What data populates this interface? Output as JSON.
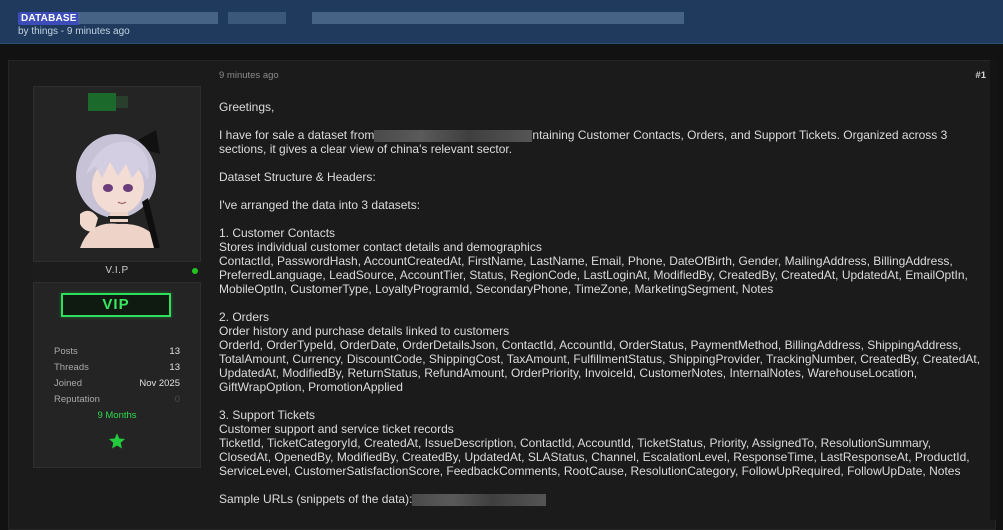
{
  "header": {
    "prefix": "DATABASE",
    "byline": "by things - 9 minutes ago"
  },
  "user": {
    "rank_title": "V.I.P",
    "badge": "VIP",
    "stats": [
      {
        "label": "Posts",
        "value": "13"
      },
      {
        "label": "Threads",
        "value": "13"
      },
      {
        "label": "Joined",
        "value": "Nov 2025"
      },
      {
        "label": "Reputation",
        "value": "0"
      }
    ],
    "membership": "9 Months"
  },
  "post": {
    "time": "9 minutes ago",
    "number": "#1",
    "greeting": "Greetings,",
    "intro_part1": "I have for sale a dataset from",
    "intro_part2": "ntaining Customer Contacts, Orders, and Support Tickets. Organized across 3",
    "intro_line2": "sections, it gives a clear view of china's relevant sector.",
    "structure_heading": "Dataset Structure & Headers:",
    "arranged": "I've arranged the data into 3 datasets:",
    "sections": [
      {
        "title": "1. Customer Contacts",
        "desc": "Stores individual customer contact details and demographics",
        "lines": [
          "ContactId, PasswordHash, AccountCreatedAt, FirstName, LastName, Email, Phone, DateOfBirth, Gender, MailingAddress, BillingAddress,",
          "PreferredLanguage, LeadSource, AccountTier, Status, RegionCode, LastLoginAt, ModifiedBy, CreatedBy, CreatedAt, UpdatedAt, EmailOptIn,",
          "MobileOptIn, CustomerType, LoyaltyProgramId, SecondaryPhone, TimeZone, MarketingSegment, Notes"
        ]
      },
      {
        "title": "2. Orders",
        "desc": "Order history and purchase details linked to customers",
        "lines": [
          "OrderId, OrderTypeId, OrderDate, OrderDetailsJson, ContactId, AccountId, OrderStatus, PaymentMethod, BillingAddress, ShippingAddress,",
          "TotalAmount, Currency, DiscountCode, ShippingCost, TaxAmount, FulfillmentStatus, ShippingProvider, TrackingNumber, CreatedBy, CreatedAt,",
          "UpdatedAt, ModifiedBy, ReturnStatus, RefundAmount, OrderPriority, InvoiceId, CustomerNotes, InternalNotes, WarehouseLocation,",
          "GiftWrapOption, PromotionApplied"
        ]
      },
      {
        "title": "3. Support Tickets",
        "desc": "Customer support and service ticket records",
        "lines": [
          "TicketId, TicketCategoryId, CreatedAt, IssueDescription, ContactId, AccountId, TicketStatus, Priority, AssignedTo, ResolutionSummary,",
          "ClosedAt, OpenedBy, ModifiedBy, CreatedBy, UpdatedAt, SLAStatus, Channel, EscalationLevel, ResponseTime, LastResponseAt, ProductId,",
          "ServiceLevel, CustomerSatisfactionScore, FeedbackComments, RootCause, ResolutionCategory, FollowUpRequired, FollowUpDate, Notes"
        ]
      }
    ],
    "sample_label": "Sample URLs (snippets of the data):"
  },
  "colors": {
    "header_bg": "#1f3a5c",
    "prefix_bg": "#3c4cb8",
    "vip_green": "#2ee05a",
    "online": "#22c422"
  }
}
